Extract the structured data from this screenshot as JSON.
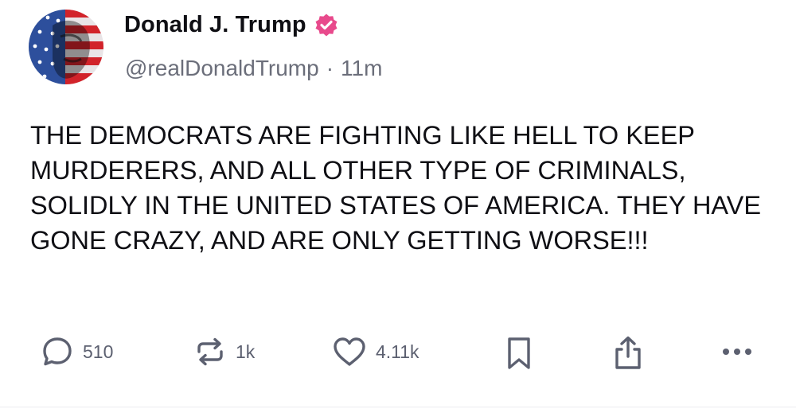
{
  "post": {
    "author": {
      "display_name": "Donald J. Trump",
      "handle": "@realDonaldTrump",
      "verified": true,
      "avatar_icon": "avatar-flag-face-icon"
    },
    "meta_separator": "·",
    "time_ago": "11m",
    "text": "THE DEMOCRATS ARE FIGHTING LIKE HELL TO KEEP MURDERERS, AND ALL OTHER TYPE OF CRIMINALS, SOLIDLY IN THE UNITED STATES OF AMERICA. THEY HAVE GONE CRAZY, AND ARE ONLY GETTING WORSE!!!"
  },
  "actions": {
    "reply": {
      "icon": "reply-icon",
      "count": "510"
    },
    "repost": {
      "icon": "repost-icon",
      "count": "1k"
    },
    "like": {
      "icon": "heart-icon",
      "count": "4.11k"
    },
    "bookmark": {
      "icon": "bookmark-icon"
    },
    "share": {
      "icon": "share-icon"
    },
    "more": {
      "icon": "more-icon"
    }
  },
  "colors": {
    "verified_badge": "#e84a8c",
    "text_primary": "#0f0f14",
    "text_secondary": "#6b6e7a",
    "action_icon": "#5c6070"
  }
}
